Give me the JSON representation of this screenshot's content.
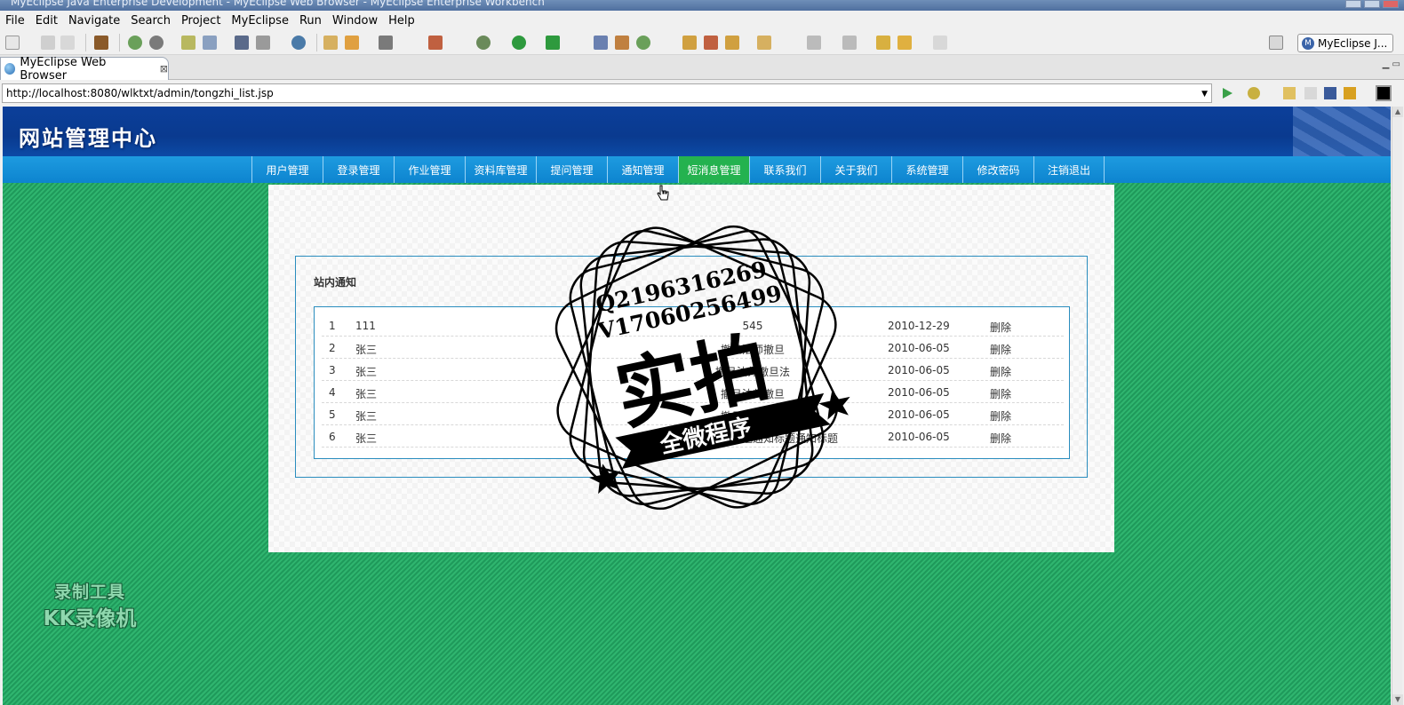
{
  "window_title": "MyEclipse Java Enterprise Development - MyEclipse Web Browser - MyEclipse Enterprise Workbench",
  "menu": [
    "File",
    "Edit",
    "Navigate",
    "Search",
    "Project",
    "MyEclipse",
    "Run",
    "Window",
    "Help"
  ],
  "perspective_label": "MyEclipse J...",
  "editor_tab": {
    "label": "MyEclipse Web Browser",
    "close": "⊠"
  },
  "url": "http://localhost:8080/wlktxt/admin/tongzhi_list.jsp",
  "site_title": "网站管理中心",
  "nav": [
    "用户管理",
    "登录管理",
    "作业管理",
    "资料库管理",
    "提问管理",
    "通知管理",
    "短消息管理",
    "联系我们",
    "关于我们",
    "系统管理",
    "修改密码",
    "注销退出"
  ],
  "nav_active_index": 6,
  "section_title": "站内通知",
  "rows": [
    {
      "num": "1",
      "name": "111",
      "title": "545",
      "date": "2010-12-29",
      "action": "删除"
    },
    {
      "num": "2",
      "name": "张三",
      "title": "撤旦法师撤旦",
      "date": "2010-06-05",
      "action": "删除"
    },
    {
      "num": "3",
      "name": "张三",
      "title": "撤旦法师撤旦法",
      "date": "2010-06-05",
      "action": "删除"
    },
    {
      "num": "4",
      "name": "张三",
      "title": "撤旦法师撤旦",
      "date": "2010-06-05",
      "action": "删除"
    },
    {
      "num": "5",
      "name": "张三",
      "title": "撤旦法师撤旦",
      "date": "2010-06-05",
      "action": "删除"
    },
    {
      "num": "6",
      "name": "张三",
      "title": "通知标题通知标题通知标题通知标题",
      "date": "2010-06-05",
      "action": "删除"
    }
  ],
  "watermark_recorder": {
    "line1": "录制工具",
    "line2": "KK录像机"
  },
  "stamp": {
    "line1": "Q2196316269",
    "line2": "V17060256499",
    "main": "实拍",
    "ribbon": "全微程序"
  },
  "colors": {
    "page_bg": "#1f9a5b",
    "nav_bg": "#1e9be0",
    "nav_active": "#24b24f",
    "banner_bg": "#0b3f9a",
    "border": "#2a8dbe"
  }
}
